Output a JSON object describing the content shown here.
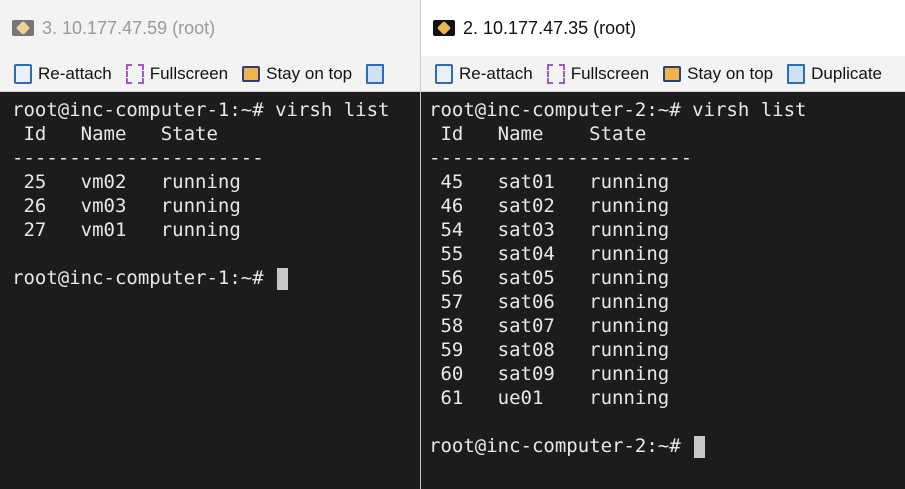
{
  "left": {
    "title": "3. 10.177.47.59 (root)",
    "toolbar": [
      "Re-attach",
      "Fullscreen",
      "Stay on top"
    ],
    "command_line": "root@inc-computer-1:~# virsh list",
    "header": " Id   Name   State",
    "separator": "----------------------",
    "rows": [
      " 25   vm02   running",
      " 26   vm03   running",
      " 27   vm01   running"
    ],
    "prompt": "root@inc-computer-1:~# "
  },
  "right": {
    "title": "2. 10.177.47.35 (root)",
    "toolbar": [
      "Re-attach",
      "Fullscreen",
      "Stay on top",
      "Duplicate"
    ],
    "command_line": "root@inc-computer-2:~# virsh list",
    "header": " Id   Name    State",
    "separator": "-----------------------",
    "rows": [
      " 45   sat01   running",
      " 46   sat02   running",
      " 54   sat03   running",
      " 55   sat04   running",
      " 56   sat05   running",
      " 57   sat06   running",
      " 58   sat07   running",
      " 59   sat08   running",
      " 60   sat09   running",
      " 61   ue01    running"
    ],
    "prompt": "root@inc-computer-2:~# "
  },
  "icons": {
    "title": "putty-icon",
    "reattach": "clipboard-icon",
    "fullscreen": "fullscreen-icon",
    "stay_on_top": "monitor-icon",
    "duplicate": "copy-icon"
  }
}
